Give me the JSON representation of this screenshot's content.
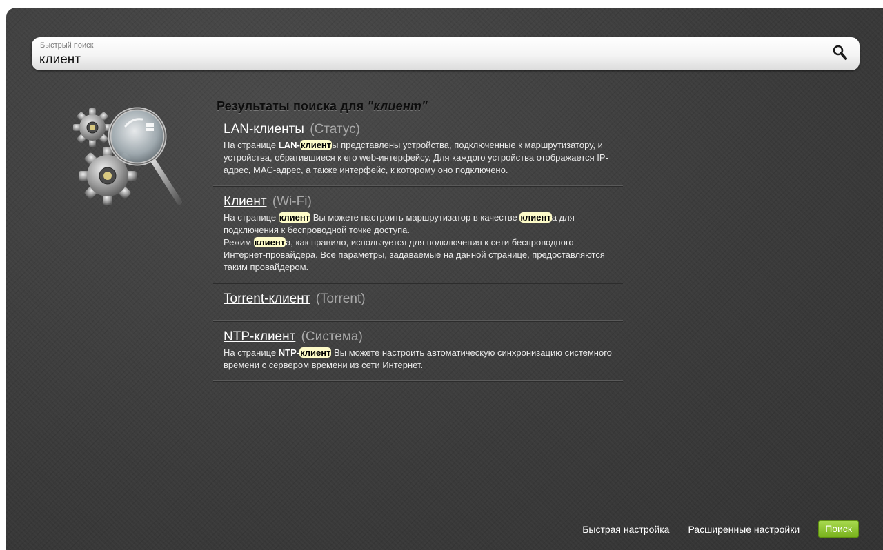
{
  "search": {
    "label": "Быстрый поиск",
    "value": "клиент",
    "icon": "search-icon"
  },
  "results": {
    "heading_prefix": "Результаты поиска для ",
    "heading_query": "\"клиент\"",
    "items": [
      {
        "title": "LAN-клиенты",
        "section": "(Статус)",
        "desc": [
          {
            "t": "На странице "
          },
          {
            "t": "LAN-",
            "b": true
          },
          {
            "t": "клиент",
            "hl": true
          },
          {
            "t": "ы представлены устройства, подключенные к маршрутизатору, и устройства, обратившиеся к его web-интерфейсу. Для каждого устройства отображается IP-адрес, MAC-адрес, а также интерфейс, к которому оно подключено."
          }
        ]
      },
      {
        "title": "Клиент",
        "section": "(Wi-Fi)",
        "desc": [
          {
            "t": "На странице "
          },
          {
            "t": "клиент",
            "hl": true
          },
          {
            "t": " Вы можете настроить маршрутизатор в качестве "
          },
          {
            "t": "клиент",
            "hl": true
          },
          {
            "t": "а для подключения к беспроводной точке доступа."
          },
          {
            "br": true
          },
          {
            "t": "Режим "
          },
          {
            "t": "клиент",
            "hl": true
          },
          {
            "t": "а, как правило, используется для подключения к сети беспроводного Интернет-провайдера. Все параметры, задаваемые на данной странице, предоставляются таким провайдером."
          }
        ]
      },
      {
        "title": "Torrent-клиент",
        "section": "(Torrent)",
        "desc": []
      },
      {
        "title": "NTP-клиент",
        "section": "(Система)",
        "desc": [
          {
            "t": "На странице "
          },
          {
            "t": "NTP-",
            "b": true
          },
          {
            "t": "клиент",
            "hl": true
          },
          {
            "t": " Вы можете настроить автоматическую синхронизацию системного времени с сервером времени из сети Интернет."
          }
        ]
      }
    ]
  },
  "footer": {
    "quick_setup": "Быстрая настройка",
    "advanced_settings": "Расширенные настройки",
    "search_button": "Поиск"
  },
  "colors": {
    "background": "#3d3d3d",
    "highlight": "#fdfbc8",
    "accent_green": "#8cc63f"
  }
}
